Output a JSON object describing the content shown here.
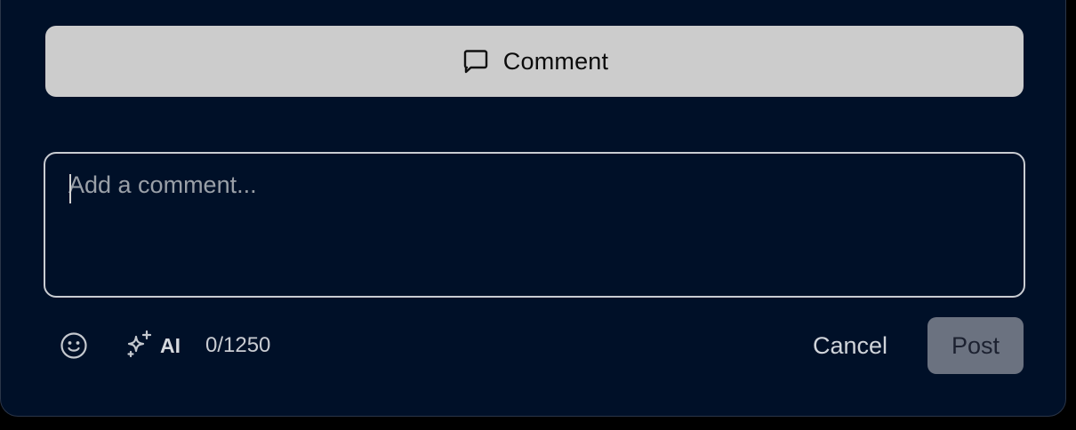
{
  "comment_toggle": {
    "label": "Comment",
    "icon": "speech-bubble-icon"
  },
  "comment_box": {
    "placeholder": "Add a comment...",
    "value": ""
  },
  "toolbar": {
    "emoji_icon": "smiley-face-icon",
    "ai_icon": "sparkles-icon",
    "ai_label": "AI",
    "char_count": "0/1250"
  },
  "actions": {
    "cancel_label": "Cancel",
    "post_label": "Post"
  },
  "colors": {
    "panel_background": "#001028",
    "comment_button_background": "#cccccc",
    "post_button_background": "#6b7280"
  }
}
